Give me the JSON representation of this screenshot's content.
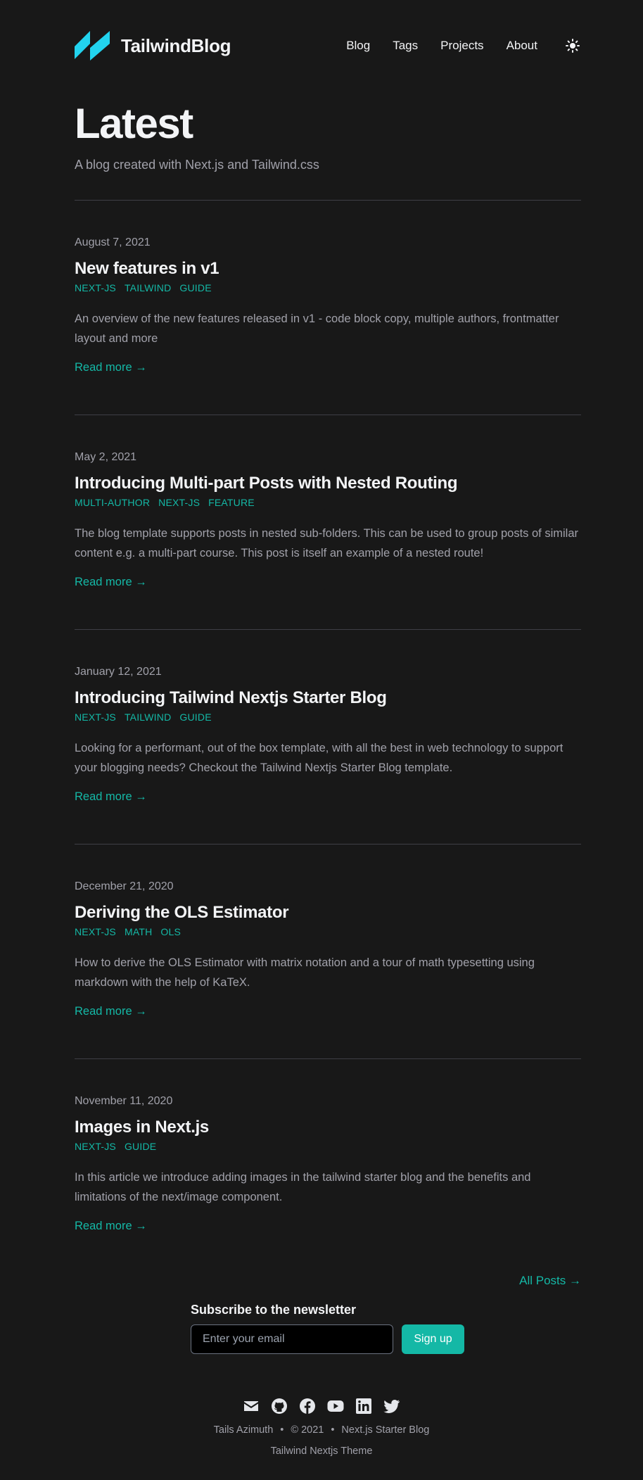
{
  "header": {
    "brand": "TailwindBlog",
    "nav": [
      "Blog",
      "Tags",
      "Projects",
      "About"
    ]
  },
  "hero": {
    "title": "Latest",
    "subtitle": "A blog created with Next.js and Tailwind.css"
  },
  "posts": [
    {
      "date": "August 7, 2021",
      "title": "New features in v1",
      "tags": [
        "NEXT-JS",
        "TAILWIND",
        "GUIDE"
      ],
      "summary": "An overview of the new features released in v1 - code block copy, multiple authors, frontmatter layout and more",
      "read_more": "Read more →"
    },
    {
      "date": "May 2, 2021",
      "title": "Introducing Multi-part Posts with Nested Routing",
      "tags": [
        "MULTI-AUTHOR",
        "NEXT-JS",
        "FEATURE"
      ],
      "summary": "The blog template supports posts in nested sub-folders. This can be used to group posts of similar content e.g. a multi-part course. This post is itself an example of a nested route!",
      "read_more": "Read more →"
    },
    {
      "date": "January 12, 2021",
      "title": "Introducing Tailwind Nextjs Starter Blog",
      "tags": [
        "NEXT-JS",
        "TAILWIND",
        "GUIDE"
      ],
      "summary": "Looking for a performant, out of the box template, with all the best in web technology to support your blogging needs? Checkout the Tailwind Nextjs Starter Blog template.",
      "read_more": "Read more →"
    },
    {
      "date": "December 21, 2020",
      "title": "Deriving the OLS Estimator",
      "tags": [
        "NEXT-JS",
        "MATH",
        "OLS"
      ],
      "summary": "How to derive the OLS Estimator with matrix notation and a tour of math typesetting using markdown with the help of KaTeX.",
      "read_more": "Read more →"
    },
    {
      "date": "November 11, 2020",
      "title": "Images in Next.js",
      "tags": [
        "NEXT-JS",
        "GUIDE"
      ],
      "summary": "In this article we introduce adding images in the tailwind starter blog and the benefits and limitations of the next/image component.",
      "read_more": "Read more →"
    }
  ],
  "all_posts": "All Posts →",
  "newsletter": {
    "title": "Subscribe to the newsletter",
    "placeholder": "Enter your email",
    "button": "Sign up"
  },
  "footer": {
    "socials": [
      "mail-icon",
      "github-icon",
      "facebook-icon",
      "youtube-icon",
      "linkedin-icon",
      "twitter-icon"
    ],
    "author": "Tails Azimuth",
    "separator": "•",
    "copyright": "© 2021",
    "site": "Next.js Starter Blog",
    "theme": "Tailwind Nextjs Theme"
  },
  "colors": {
    "background": "#181818",
    "accent": "#14b8a6",
    "logo": "#22d3ee"
  }
}
